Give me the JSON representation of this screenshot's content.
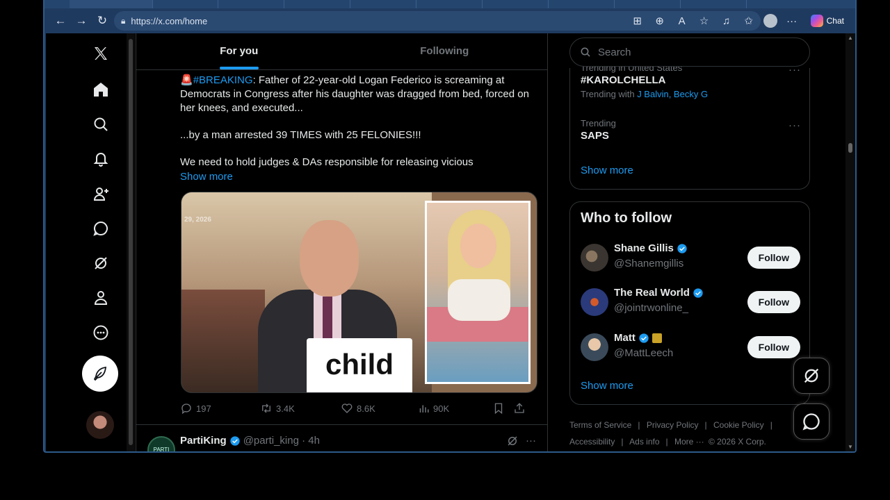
{
  "browser": {
    "url": "https://x.com/home",
    "chat_label": "Chat"
  },
  "tabs": [
    {
      "label": "For you",
      "active": true
    },
    {
      "label": "Following",
      "active": false
    }
  ],
  "nav": {
    "icons": [
      "x-logo-icon",
      "home-icon",
      "search-icon",
      "notifications-icon",
      "follow-icon",
      "messages-icon",
      "grok-icon",
      "profile-icon",
      "more-icon"
    ]
  },
  "tweet": {
    "paragraph1_prefix": "🚨",
    "hashtag": "#BREAKING",
    "paragraph1_rest": ": Father of 22-year-old Logan Federico is screaming at Democrats in Congress after his daughter was dragged from bed, forced on her knees, and executed...",
    "paragraph2": "...by a man arrested 39 TIMES with 25 FELONIES!!!",
    "paragraph3": "We need to hold judges & DAs responsible for releasing vicious",
    "show_more": "Show more",
    "media_date": "29, 2026",
    "media_caption": "child",
    "replies": "197",
    "reposts": "3.4K",
    "likes": "8.6K",
    "views": "90K"
  },
  "tweet2": {
    "avatar_text": "PARTI KING",
    "name": "PartiKing",
    "handle": "@parti_king · 4h"
  },
  "sidebar": {
    "search_placeholder": "Search",
    "trends": [
      {
        "context": "Trending in United States",
        "name": "#KAROLCHELLA",
        "with_label": "Trending with",
        "with_names": "J Balvin, Becky G"
      },
      {
        "context": "Trending",
        "name": "SAPS"
      }
    ],
    "trends_show_more": "Show more",
    "who_to_follow_title": "Who to follow",
    "users": [
      {
        "name": "Shane Gillis",
        "handle": "@Shanemgillis",
        "follow": "Follow"
      },
      {
        "name": "The Real World",
        "handle": "@jointrwonline_",
        "follow": "Follow"
      },
      {
        "name": "Matt",
        "handle": "@MattLeech",
        "follow": "Follow"
      }
    ],
    "wtf_show_more": "Show more",
    "footer": {
      "terms": "Terms of Service",
      "privacy": "Privacy Policy",
      "cookie": "Cookie Policy",
      "accessibility": "Accessibility",
      "ads": "Ads info",
      "more": "More ···",
      "copyright": "© 2026 X Corp."
    }
  },
  "colors": {
    "accent": "#1d9bf0",
    "border": "#2f3336",
    "muted": "#71767b"
  }
}
